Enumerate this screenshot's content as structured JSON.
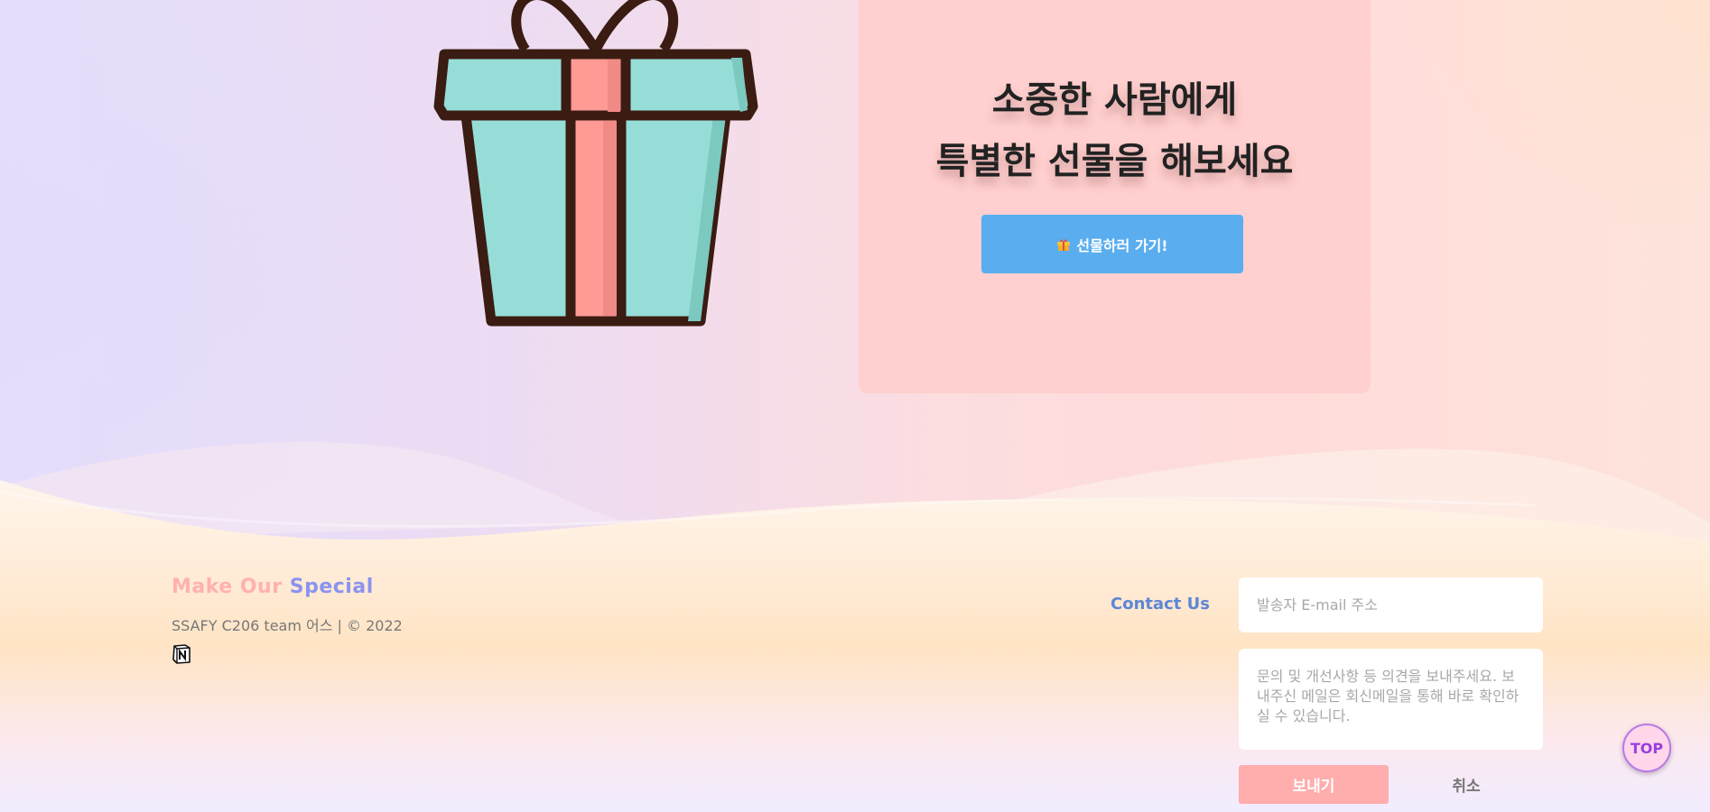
{
  "promo": {
    "title_line1": "소중한 사람에게",
    "title_line2": "특별한 선물을 해보세요",
    "button_label": "선물하러 가기!",
    "button_icon": "gift-emoji"
  },
  "footer": {
    "brand_part1": "Make Our",
    "brand_part2": "Special",
    "copyright": "SSAFY C206 team 어스 | © 2022",
    "notion_icon": "notion-icon"
  },
  "contact": {
    "label": "Contact Us",
    "email_placeholder": "발송자 E-mail 주소",
    "message_placeholder": "문의 및 개선사항 등 의견을 보내주세요. 보내주신 메일은 회신메일을 통해 바로 확인하실 수 있습니다.",
    "send_label": "보내기",
    "cancel_label": "취소"
  },
  "top_button": {
    "label": "TOP"
  },
  "colors": {
    "card_bg": "#ffd0cf",
    "button_blue": "#5aaeef",
    "brand_pink": "#ffb1b1",
    "brand_blue": "#8b93f0",
    "contact_blue": "#5c86d6",
    "send_pink": "#ffadad",
    "gift_teal": "#96ddd8",
    "gift_ribbon": "#ff9a95",
    "gift_outline": "#3b1c12"
  }
}
